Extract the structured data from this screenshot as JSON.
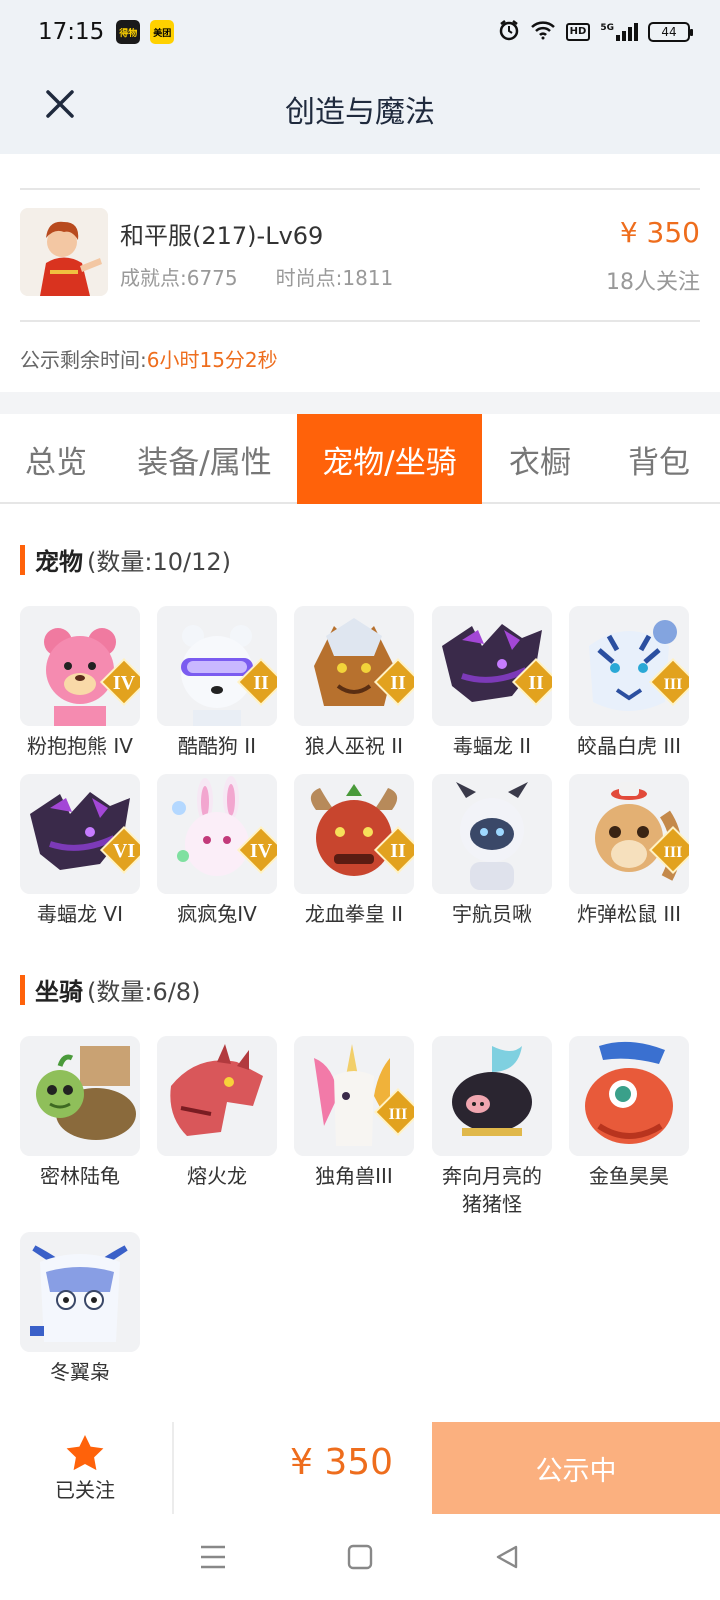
{
  "status_bar": {
    "time": "17:15",
    "app_badge_1": "得物",
    "app_badge_2": "美团",
    "hd": "HD",
    "network": "5G",
    "battery": "44"
  },
  "header": {
    "title": "创造与魔法"
  },
  "account": {
    "name": "和平服(217)-Lv69",
    "achievement": "成就点:6775",
    "fashion": "时尚点:1811",
    "price": "¥ 350",
    "followers": "18人关注",
    "notice_label": "公示剩余时间:",
    "notice_time": "6小时15分2秒"
  },
  "tabs": [
    {
      "label": "总览"
    },
    {
      "label": "装备/属性"
    },
    {
      "label": "宠物/坐骑"
    },
    {
      "label": "衣橱"
    },
    {
      "label": "背包"
    }
  ],
  "pets": {
    "title": "宠物",
    "count": "(数量:10/12)",
    "items": [
      {
        "label": "粉抱抱熊 IV",
        "icon": "pink-bear-icon",
        "rank": "IV"
      },
      {
        "label": "酷酷狗 II",
        "icon": "cool-dog-icon",
        "rank": "II"
      },
      {
        "label": "狼人巫祝 II",
        "icon": "werewolf-shaman-icon",
        "rank": "II"
      },
      {
        "label": "毒蝠龙 II",
        "icon": "poison-bat-dragon-icon",
        "rank": "II"
      },
      {
        "label": "皎晶白虎 III",
        "icon": "crystal-white-tiger-icon",
        "rank": "III"
      },
      {
        "label": "毒蝠龙 VI",
        "icon": "poison-bat-dragon-icon",
        "rank": "VI"
      },
      {
        "label": "疯疯兔IV",
        "icon": "crazy-rabbit-icon",
        "rank": "IV"
      },
      {
        "label": "龙血拳皇 II",
        "icon": "dragon-blood-boxer-icon",
        "rank": "II"
      },
      {
        "label": "宇航员啾",
        "icon": "astronaut-chick-icon",
        "rank": ""
      },
      {
        "label": "炸弹松鼠 III",
        "icon": "bomb-squirrel-icon",
        "rank": "III"
      }
    ]
  },
  "mounts": {
    "title": "坐骑",
    "count": "(数量:6/8)",
    "items": [
      {
        "label": "密林陆龟",
        "icon": "forest-tortoise-icon",
        "rank": ""
      },
      {
        "label": "熔火龙",
        "icon": "molten-dragon-icon",
        "rank": ""
      },
      {
        "label": "独角兽III",
        "icon": "unicorn-icon",
        "rank": "III"
      },
      {
        "label": "奔向月亮的猪猪怪",
        "icon": "moon-pig-icon",
        "rank": ""
      },
      {
        "label": "金鱼昊昊",
        "icon": "goldfish-icon",
        "rank": ""
      },
      {
        "label": "冬翼枭",
        "icon": "winter-owl-icon",
        "rank": ""
      }
    ]
  },
  "action_bar": {
    "follow_label": "已关注",
    "price": "¥ 350",
    "status_button": "公示中"
  },
  "colors": {
    "accent": "#ff620a",
    "price": "#ee6d1d",
    "status_button": "#fbb07f"
  }
}
